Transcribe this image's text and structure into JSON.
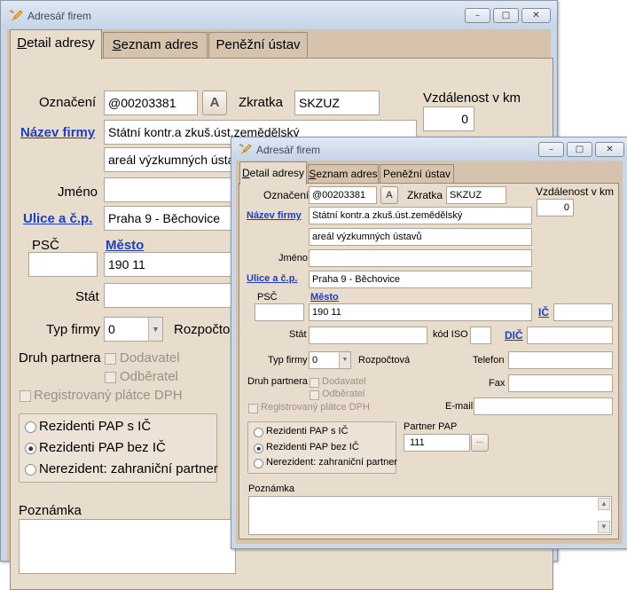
{
  "window": {
    "title": "Adresář firem",
    "buttons": {
      "minimize": "–",
      "maximize": "□",
      "close": "✕"
    }
  },
  "tabs": [
    "Detail adresy",
    "Seznam adres",
    "Peněžní ústav"
  ],
  "tabs_accel": [
    "D",
    "S",
    ""
  ],
  "tabs_rest": [
    "etail adresy",
    "eznam adres",
    "Peněžní ústav"
  ],
  "labels": {
    "oznaceni": "Označení",
    "zkratka": "Zkratka",
    "vzdalenost": "Vzdálenost v km",
    "nazev_firmy": "Název firmy",
    "jmeno": "Jméno",
    "ulice": "Ulice a č.p.",
    "psc": "PSČ",
    "mesto": "Město",
    "ic": "IČ",
    "stat": "Stát",
    "kod_iso": "kód ISO",
    "dic": "DIČ",
    "typ_firmy": "Typ firmy",
    "rozpoctova": "Rozpočtová",
    "rozpocto_clipped": "Rozpočto",
    "telefon": "Telefon",
    "fax": "Fax",
    "email": "E-mail",
    "druh_partnera": "Druh partnera",
    "dodavatel": "Dodavatel",
    "odberatel": "Odběratel",
    "dph": "Registrovaný plátce DPH",
    "partner_pap": "Partner PAP",
    "poznamka": "Poznámka",
    "a_button": "A",
    "ellipsis": "..."
  },
  "radios": [
    {
      "label": "Rezidenti PAP s IČ",
      "checked": false
    },
    {
      "label": "Rezidenti PAP bez IČ",
      "checked": true
    },
    {
      "label": "Nerezident: zahraniční partner",
      "checked": false
    }
  ],
  "values": {
    "oznaceni": "@00203381",
    "zkratka": "SKZUZ",
    "vzdalenost": "0",
    "nazev1": "Státní kontr.a zkuš.úst.zemědělský",
    "nazev2": "areál výzkumných ústavů",
    "jmeno": "",
    "ulice": "Praha 9 - Běchovice",
    "psc": "",
    "mesto": "190 11",
    "ic": "",
    "stat": "",
    "kod_iso": "",
    "dic": "",
    "typ_firmy": "0",
    "telefon": "",
    "fax": "",
    "email": "",
    "partner_pap": "111",
    "poznamka": ""
  },
  "icons": {
    "app": "pen-writing-icon",
    "dropdown": "dropdown-arrow-icon"
  },
  "colors": {
    "client_bg": "#d6c3ad",
    "panel_bg": "#e8dccd",
    "link": "#1f3fbf",
    "titlebar": "#c9d7e8"
  }
}
